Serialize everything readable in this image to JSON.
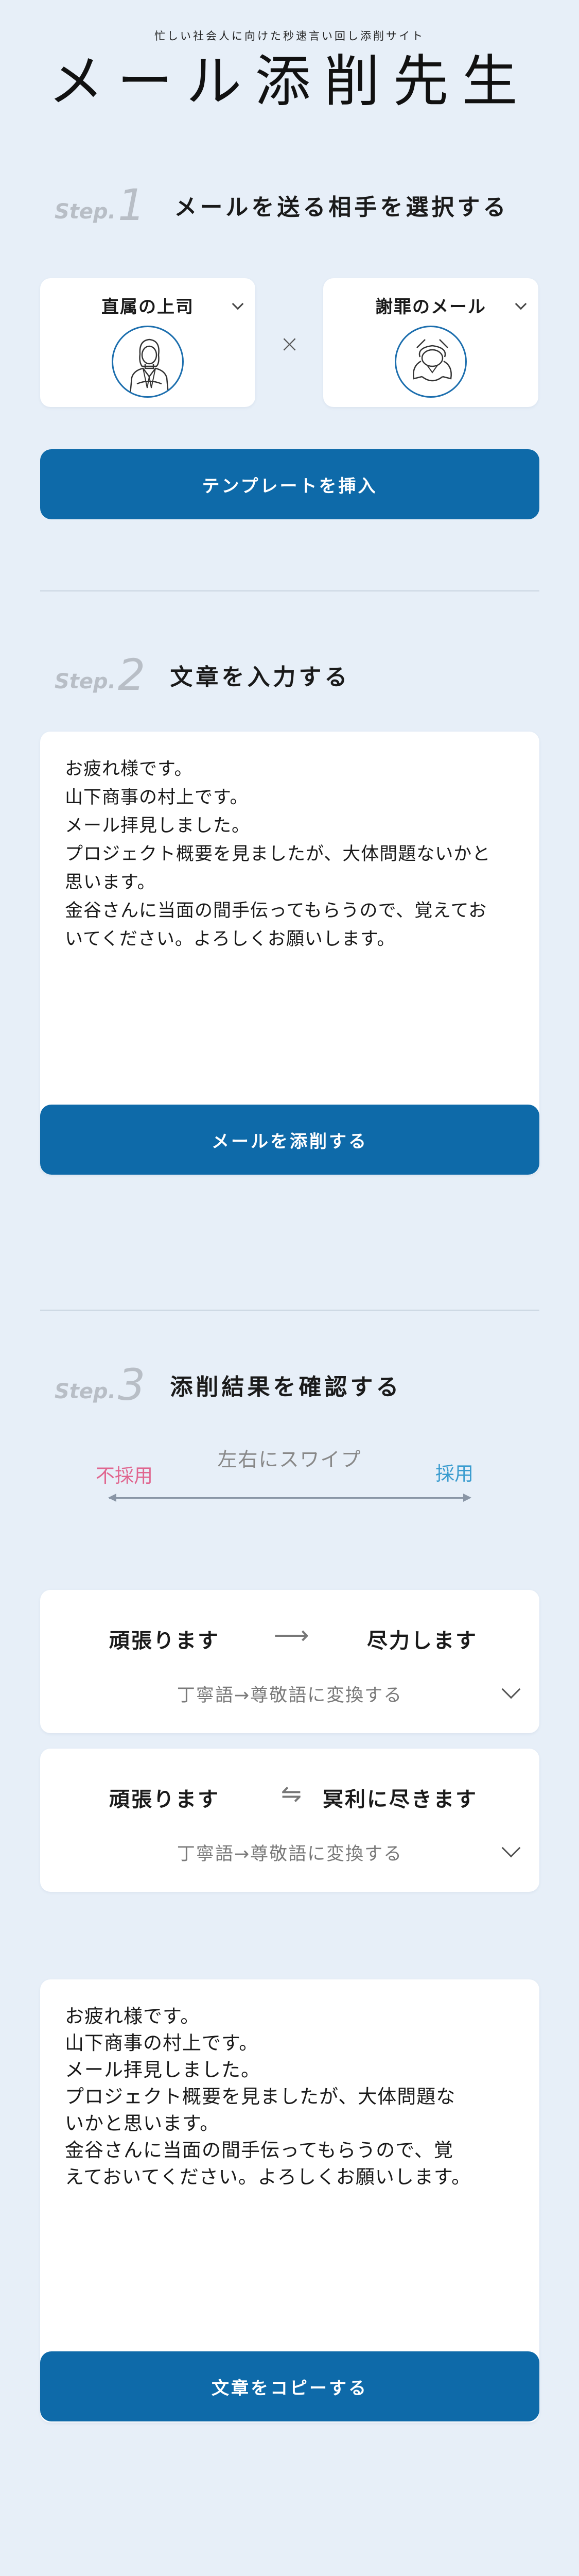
{
  "header": {
    "tagline": "忙しい社会人に向けた秒速言い回し添削サイト",
    "title": "メール添削先生"
  },
  "step_word": "Step.",
  "step1": {
    "number": "1",
    "title": "メールを送る相手を選択する",
    "recipient_select": {
      "value": "直属の上司",
      "icon": "businesswoman-illustration"
    },
    "type_select": {
      "value": "謝罪のメール",
      "icon": "bowing-person-illustration"
    },
    "times_symbol": "×",
    "insert_button": "テンプレートを挿入"
  },
  "step2": {
    "number": "2",
    "title": "文章を入力する",
    "text_lines": [
      "お疲れ様です。",
      "山下商事の村上です。",
      "メール拝見しました。",
      "プロジェクト概要を見ましたが、大体問題ないかと",
      "思います。",
      "金谷さんに当面の間手伝ってもらうので、覚えてお",
      "いてください。よろしくお願いします。"
    ],
    "submit_button": "メールを添削する"
  },
  "step3": {
    "number": "3",
    "title": "添削結果を確認する",
    "swipe_label": "左右にスワイプ",
    "reject_label": "不採用",
    "adopt_label": "採用",
    "suggestions": [
      {
        "from": "頑張ります",
        "arrow": "⟶",
        "to": "尽力します",
        "description": "丁寧語→尊敬語に変換する"
      },
      {
        "from": "頑張ります",
        "arrow": "⇋",
        "to": "冥利に尽きます",
        "description": "丁寧語→尊敬語に変換する"
      }
    ],
    "result_lines": [
      "お疲れ様です。",
      "山下商事の村上です。",
      "メール拝見しました。",
      "プロジェクト概要を見ましたが、大体問題な",
      "いかと思います。",
      "金谷さんに当面の間手伝ってもらうので、覚",
      "えておいてください。よろしくお願いします。"
    ],
    "copy_button": "文章をコピーする"
  },
  "colors": {
    "background": "#e7eff8",
    "primary_button": "#0e6aa9",
    "reject": "#e0668f",
    "adopt": "#3a9ccf"
  }
}
